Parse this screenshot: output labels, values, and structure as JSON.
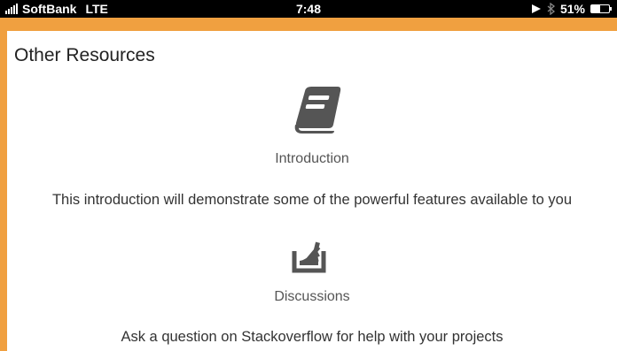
{
  "status_bar": {
    "carrier": "SoftBank",
    "network": "LTE",
    "time": "7:48",
    "battery_text": "51%",
    "battery_level": 0.51
  },
  "page": {
    "title": "Other Resources"
  },
  "resources": [
    {
      "icon": "book-icon",
      "label": "Introduction",
      "description": "This introduction will demonstrate some of the powerful features available to you"
    },
    {
      "icon": "stackoverflow-icon",
      "label": "Discussions",
      "description": "Ask a question on Stackoverflow for help with your projects"
    }
  ],
  "colors": {
    "frame": "#f0a040",
    "icon": "#555555"
  }
}
